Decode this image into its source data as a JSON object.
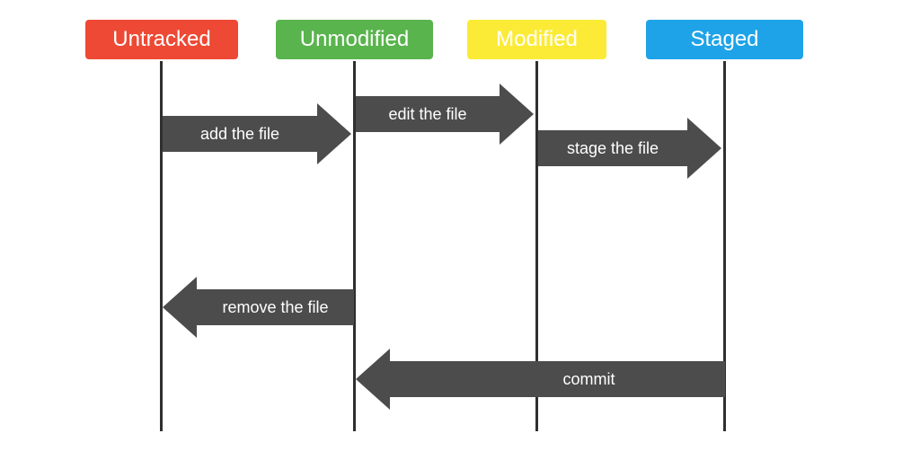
{
  "states": [
    {
      "key": "untracked",
      "label": "Untracked",
      "color": "#ed4934"
    },
    {
      "key": "unmodified",
      "label": "Unmodified",
      "color": "#59b44d"
    },
    {
      "key": "modified",
      "label": "Modified",
      "color": "#fbeb37"
    },
    {
      "key": "staged",
      "label": "Staged",
      "color": "#1ea3e8"
    }
  ],
  "transitions": {
    "add": {
      "label": "add the file",
      "from": "untracked",
      "to": "unmodified",
      "dir": "right"
    },
    "edit": {
      "label": "edit the file",
      "from": "unmodified",
      "to": "modified",
      "dir": "right"
    },
    "stage": {
      "label": "stage the file",
      "from": "modified",
      "to": "staged",
      "dir": "right"
    },
    "remove": {
      "label": "remove the file",
      "from": "unmodified",
      "to": "untracked",
      "dir": "left"
    },
    "commit": {
      "label": "commit",
      "from": "staged",
      "to": "unmodified",
      "dir": "left"
    }
  },
  "colors": {
    "arrow": "#4c4c4c",
    "line": "#2f2f2f",
    "text_on_state": "#ffffff"
  }
}
